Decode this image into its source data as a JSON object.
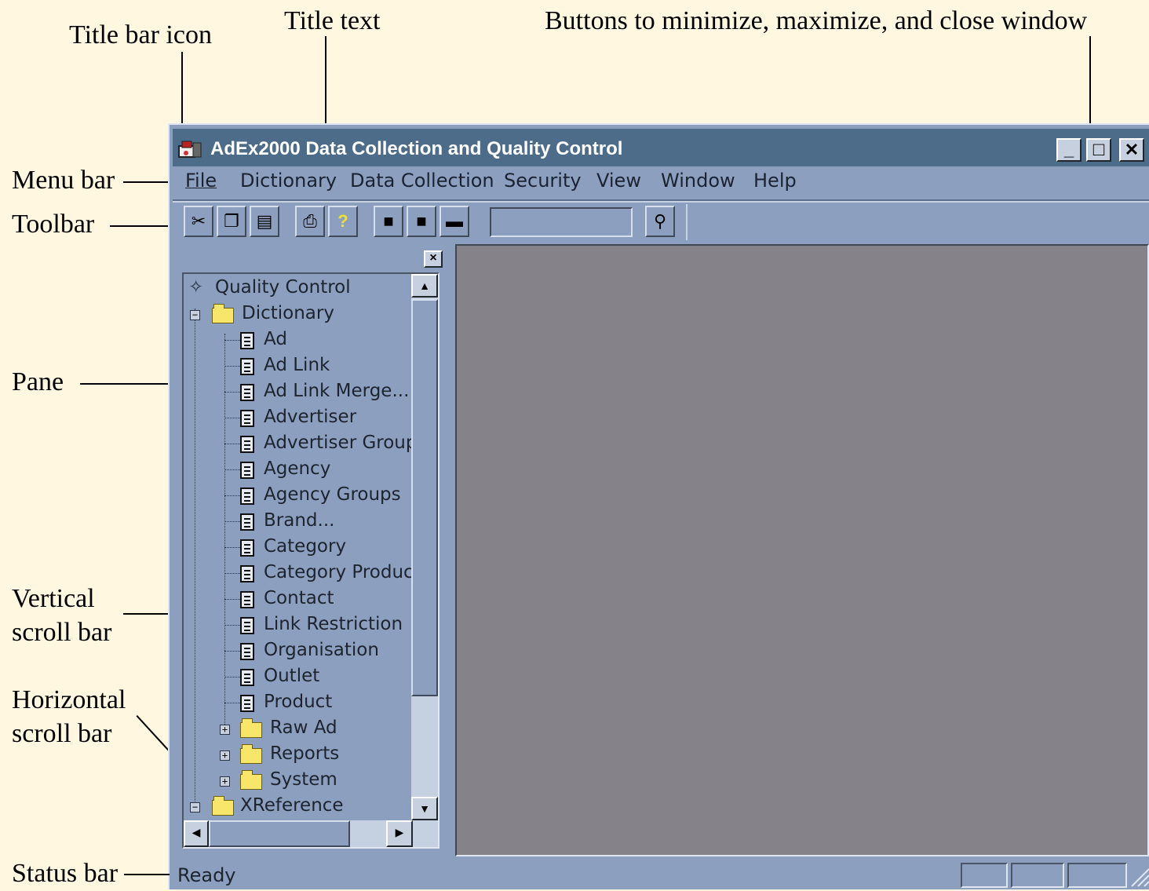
{
  "annotations": {
    "title_bar_icon": "Title bar icon",
    "title_text": "Title text",
    "window_buttons": "Buttons to minimize, maximize, and close window",
    "menu_bar": "Menu bar",
    "toolbar": "Toolbar",
    "pane": "Pane",
    "vertical_scroll_bar_1": "Vertical",
    "vertical_scroll_bar_2": "scroll  bar",
    "horizontal_scroll_bar_1": "Horizontal",
    "horizontal_scroll_bar_2": "scroll  bar",
    "status_bar": "Status bar"
  },
  "window": {
    "title": "AdEx2000 Data Collection and Quality Control",
    "buttons": {
      "minimize": "_",
      "maximize": "□",
      "close": "✕"
    }
  },
  "menu": [
    "File",
    "Dictionary",
    "Data Collection",
    "Security",
    "View",
    "Window",
    "Help"
  ],
  "toolbar": {
    "buttons": [
      "cut-icon",
      "copy-icon",
      "paste-icon",
      "print-icon",
      "help-icon",
      "tile-icon",
      "cascade-icon",
      "arrange-icon",
      "find-icon"
    ],
    "combo_value": ""
  },
  "pane": {
    "close": "×",
    "tree": {
      "root": "Quality Control",
      "dictionary": "Dictionary",
      "dictionary_items": [
        "Ad",
        "Ad Link",
        "Ad Link Merge...",
        "Advertiser",
        "Advertiser Group",
        "Agency",
        "Agency Groups",
        "Brand...",
        "Category",
        "Category Product",
        "Contact",
        "Link Restriction",
        "Organisation",
        "Outlet",
        "Product"
      ],
      "subfolders": [
        "Raw Ad",
        "Reports",
        "System"
      ],
      "xreference": "XReference"
    }
  },
  "statusbar": {
    "text": "Ready"
  }
}
